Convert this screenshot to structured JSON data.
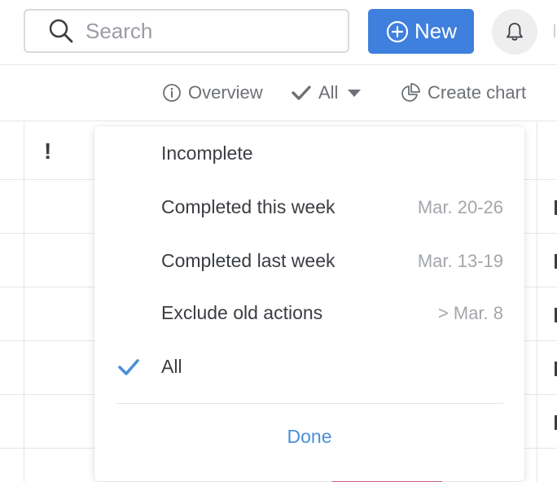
{
  "header": {
    "search": {
      "placeholder": "Search",
      "value": ""
    },
    "new_button": {
      "label": "New"
    }
  },
  "toolbar": {
    "overview_label": "Overview",
    "filter_label": "All",
    "create_chart_label": "Create chart"
  },
  "table": {
    "header_icon_text": "!"
  },
  "filter_menu": {
    "options": [
      {
        "label": "Incomplete",
        "range": "",
        "selected": false
      },
      {
        "label": "Completed this week",
        "range": "Mar. 20-26",
        "selected": false
      },
      {
        "label": "Completed last week",
        "range": "Mar. 13-19",
        "selected": false
      },
      {
        "label": "Exclude old actions",
        "range": "> Mar. 8",
        "selected": false
      },
      {
        "label": "All",
        "range": "",
        "selected": true
      }
    ],
    "done_label": "Done"
  },
  "colors": {
    "accent": "#3f7fdd",
    "check": "#4a8fd8",
    "muted_text": "#a3a6ab"
  }
}
